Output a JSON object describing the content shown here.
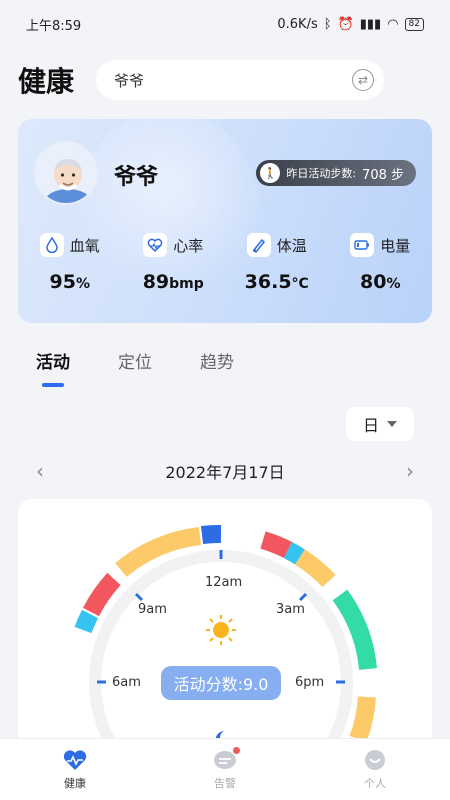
{
  "status_bar": {
    "time": "上午8:59",
    "speed": "0.6K/s",
    "battery": "82"
  },
  "header": {
    "title": "健康",
    "search_value": "爷爷"
  },
  "profile": {
    "name": "爷爷",
    "steps_label": "昨日活动步数:",
    "steps_value": "708 步",
    "metrics": [
      {
        "label": "血氧",
        "value": "95",
        "unit": "%"
      },
      {
        "label": "心率",
        "value": "89",
        "unit": "bmp"
      },
      {
        "label": "体温",
        "value": "36.5",
        "unit": "°C"
      },
      {
        "label": "电量",
        "value": "80",
        "unit": "%"
      }
    ]
  },
  "tabs": [
    "活动",
    "定位",
    "趋势"
  ],
  "period": "日",
  "date": "2022年7月17日",
  "activity": {
    "score_label": "活动分数:9.0",
    "clock_labels": {
      "top": "12am",
      "nine": "9am",
      "three": "3am",
      "six_am": "6am",
      "six_pm": "6pm"
    },
    "colors": {
      "yellow": "#fdca6a",
      "red": "#f2565e",
      "cyan": "#35c3f0",
      "green": "#33dba6",
      "blue": "#2c6de6",
      "gray": "#f2f2f4"
    }
  },
  "bottom_nav": [
    {
      "label": "健康",
      "active": true
    },
    {
      "label": "告警",
      "active": false
    },
    {
      "label": "个人",
      "active": false
    }
  ]
}
